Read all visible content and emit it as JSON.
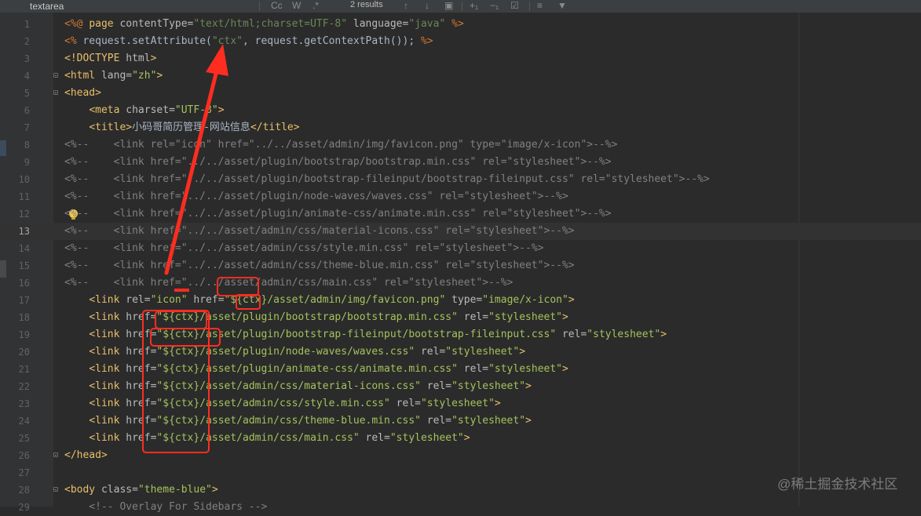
{
  "search": {
    "value": "textarea",
    "results": "2 results"
  },
  "toolbar": {
    "case_label": "Cc",
    "word_label": "W",
    "regex_label": ".*"
  },
  "current_line": 13,
  "lines": [
    {
      "n": 1,
      "segs": [
        [
          "jsp",
          "<%@ "
        ],
        [
          "tag",
          "page "
        ],
        [
          "attr",
          "contentType="
        ],
        [
          "str",
          "\"text/html;charset=UTF-8\" "
        ],
        [
          "attr",
          "language="
        ],
        [
          "str",
          "\"java\" "
        ],
        [
          "jsp",
          "%>"
        ]
      ]
    },
    {
      "n": 2,
      "segs": [
        [
          "jsp",
          "<% "
        ],
        [
          "text",
          "request.setAttribute("
        ],
        [
          "str",
          "\"ctx\""
        ],
        [
          "text",
          ", request.getContextPath()); "
        ],
        [
          "jsp",
          "%>"
        ]
      ]
    },
    {
      "n": 3,
      "segs": [
        [
          "tag",
          "<!DOCTYPE "
        ],
        [
          "attr",
          "html"
        ],
        [
          "tag",
          ">"
        ]
      ]
    },
    {
      "n": 4,
      "segs": [
        [
          "tag",
          "<html "
        ],
        [
          "attr",
          "lang="
        ],
        [
          "val",
          "\"zh\""
        ],
        [
          "tag",
          ">"
        ]
      ]
    },
    {
      "n": 5,
      "segs": [
        [
          "tag",
          "<head>"
        ]
      ]
    },
    {
      "n": 6,
      "segs": [
        [
          "text",
          "    "
        ],
        [
          "tag",
          "<meta "
        ],
        [
          "attr",
          "charset="
        ],
        [
          "val",
          "\"UTF-8\""
        ],
        [
          "tag",
          ">"
        ]
      ]
    },
    {
      "n": 7,
      "segs": [
        [
          "text",
          "    "
        ],
        [
          "tag",
          "<title>"
        ],
        [
          "text",
          "小码哥简历管理-网站信息"
        ],
        [
          "tag",
          "</title>"
        ]
      ]
    },
    {
      "n": 8,
      "segs": [
        [
          "cmt",
          "<%--    <link rel=\"icon\" href=\"../../asset/admin/img/favicon.png\" type=\"image/x-icon\">--%>"
        ]
      ]
    },
    {
      "n": 9,
      "segs": [
        [
          "cmt",
          "<%--    <link href=\"../../asset/plugin/bootstrap/bootstrap.min.css\" rel=\"stylesheet\">--%>"
        ]
      ]
    },
    {
      "n": 10,
      "segs": [
        [
          "cmt",
          "<%--    <link href=\"../../asset/plugin/bootstrap-fileinput/bootstrap-fileinput.css\" rel=\"stylesheet\">--%>"
        ]
      ]
    },
    {
      "n": 11,
      "segs": [
        [
          "cmt",
          "<%--    <link href=\"../../asset/plugin/node-waves/waves.css\" rel=\"stylesheet\">--%>"
        ]
      ]
    },
    {
      "n": 12,
      "segs": [
        [
          "cmt",
          "<%--    <link href=\"../../asset/plugin/animate-css/animate.min.css\" rel=\"stylesheet\">--%>"
        ]
      ]
    },
    {
      "n": 13,
      "segs": [
        [
          "cmt",
          "<%--    <link href=\"../../asset/admin/css/material-icons.css\" rel=\"stylesheet\">--%>"
        ]
      ]
    },
    {
      "n": 14,
      "segs": [
        [
          "cmt",
          "<%--    <link href=\"../../asset/admin/css/style.min.css\" rel=\"stylesheet\">--%>"
        ]
      ]
    },
    {
      "n": 15,
      "segs": [
        [
          "cmt",
          "<%--    <link href=\"../../asset/admin/css/theme-blue.min.css\" rel=\"stylesheet\">--%>"
        ]
      ]
    },
    {
      "n": 16,
      "segs": [
        [
          "cmt",
          "<%--    <link href=\"../../asset/admin/css/main.css\" rel=\"stylesheet\">--%>"
        ]
      ]
    },
    {
      "n": 17,
      "segs": [
        [
          "text",
          "    "
        ],
        [
          "tag",
          "<link "
        ],
        [
          "attr",
          "rel="
        ],
        [
          "val",
          "\"icon\" "
        ],
        [
          "attr",
          "href="
        ],
        [
          "val",
          "\"${ctx}/asset/admin/img/favicon.png\" "
        ],
        [
          "attr",
          "type="
        ],
        [
          "val",
          "\"image/x-icon\""
        ],
        [
          "tag",
          ">"
        ]
      ]
    },
    {
      "n": 18,
      "segs": [
        [
          "text",
          "    "
        ],
        [
          "tag",
          "<link "
        ],
        [
          "attr",
          "href="
        ],
        [
          "val",
          "\"${ctx}/asset/plugin/bootstrap/bootstrap.min.css\" "
        ],
        [
          "attr",
          "rel="
        ],
        [
          "val",
          "\"stylesheet\""
        ],
        [
          "tag",
          ">"
        ]
      ]
    },
    {
      "n": 19,
      "segs": [
        [
          "text",
          "    "
        ],
        [
          "tag",
          "<link "
        ],
        [
          "attr",
          "href="
        ],
        [
          "val",
          "\"${ctx}/asset/plugin/bootstrap-fileinput/bootstrap-fileinput.css\" "
        ],
        [
          "attr",
          "rel="
        ],
        [
          "val",
          "\"stylesheet\""
        ],
        [
          "tag",
          ">"
        ]
      ]
    },
    {
      "n": 20,
      "segs": [
        [
          "text",
          "    "
        ],
        [
          "tag",
          "<link "
        ],
        [
          "attr",
          "href="
        ],
        [
          "val",
          "\"${ctx}/asset/plugin/node-waves/waves.css\" "
        ],
        [
          "attr",
          "rel="
        ],
        [
          "val",
          "\"stylesheet\""
        ],
        [
          "tag",
          ">"
        ]
      ]
    },
    {
      "n": 21,
      "segs": [
        [
          "text",
          "    "
        ],
        [
          "tag",
          "<link "
        ],
        [
          "attr",
          "href="
        ],
        [
          "val",
          "\"${ctx}/asset/plugin/animate-css/animate.min.css\" "
        ],
        [
          "attr",
          "rel="
        ],
        [
          "val",
          "\"stylesheet\""
        ],
        [
          "tag",
          ">"
        ]
      ]
    },
    {
      "n": 22,
      "segs": [
        [
          "text",
          "    "
        ],
        [
          "tag",
          "<link "
        ],
        [
          "attr",
          "href="
        ],
        [
          "val",
          "\"${ctx}/asset/admin/css/material-icons.css\" "
        ],
        [
          "attr",
          "rel="
        ],
        [
          "val",
          "\"stylesheet\""
        ],
        [
          "tag",
          ">"
        ]
      ]
    },
    {
      "n": 23,
      "segs": [
        [
          "text",
          "    "
        ],
        [
          "tag",
          "<link "
        ],
        [
          "attr",
          "href="
        ],
        [
          "val",
          "\"${ctx}/asset/admin/css/style.min.css\" "
        ],
        [
          "attr",
          "rel="
        ],
        [
          "val",
          "\"stylesheet\""
        ],
        [
          "tag",
          ">"
        ]
      ]
    },
    {
      "n": 24,
      "segs": [
        [
          "text",
          "    "
        ],
        [
          "tag",
          "<link "
        ],
        [
          "attr",
          "href="
        ],
        [
          "val",
          "\"${ctx}/asset/admin/css/theme-blue.min.css\" "
        ],
        [
          "attr",
          "rel="
        ],
        [
          "val",
          "\"stylesheet\""
        ],
        [
          "tag",
          ">"
        ]
      ]
    },
    {
      "n": 25,
      "segs": [
        [
          "text",
          "    "
        ],
        [
          "tag",
          "<link "
        ],
        [
          "attr",
          "href="
        ],
        [
          "val",
          "\"${ctx}/asset/admin/css/main.css\" "
        ],
        [
          "attr",
          "rel="
        ],
        [
          "val",
          "\"stylesheet\""
        ],
        [
          "tag",
          ">"
        ]
      ]
    },
    {
      "n": 26,
      "segs": [
        [
          "tag",
          "</head>"
        ]
      ]
    },
    {
      "n": 27,
      "segs": []
    },
    {
      "n": 28,
      "segs": [
        [
          "tag",
          "<body "
        ],
        [
          "attr",
          "class="
        ],
        [
          "val",
          "\"theme-blue\""
        ],
        [
          "tag",
          ">"
        ]
      ]
    },
    {
      "n": 29,
      "segs": [
        [
          "cmt",
          "    <!-- Overlay For Sidebars -->"
        ]
      ]
    }
  ],
  "fold_lines": [
    4,
    5,
    26,
    28
  ],
  "bulb_line": 12,
  "watermark": "@稀土掘金技术社区",
  "colors": {
    "annotation": "#ff2d20",
    "background": "#2b2b2b",
    "gutter": "#313335"
  }
}
